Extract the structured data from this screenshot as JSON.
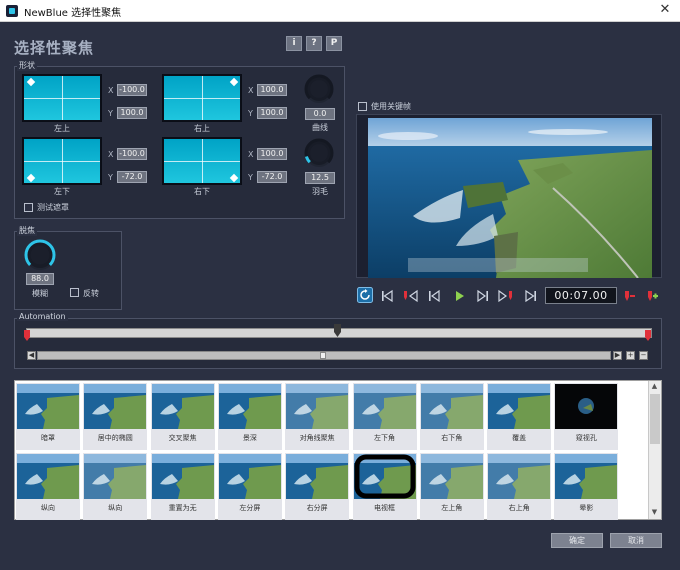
{
  "window": {
    "title": "NewBlue 选择性聚焦",
    "close": "✕"
  },
  "heading": "选择性聚焦",
  "header_buttons": {
    "info": "i",
    "help": "?",
    "presets": "P"
  },
  "shape": {
    "label": "形状",
    "top_left": {
      "label": "左上",
      "x": "-100.0",
      "y": "100.0"
    },
    "top_right": {
      "label": "右上",
      "x": "100.0",
      "y": "100.0"
    },
    "bottom_left": {
      "label": "左下",
      "x": "-100.0",
      "y": "-72.0"
    },
    "bottom_right": {
      "label": "右下",
      "x": "100.0",
      "y": "-72.0"
    },
    "curve": {
      "label": "曲线",
      "value": "0.0"
    },
    "feather": {
      "label": "羽毛",
      "value": "12.5"
    },
    "test_mask": {
      "label": "测试遮罩",
      "checked": false
    },
    "x_label": "X",
    "y_label": "Y"
  },
  "defocus": {
    "label": "脱焦",
    "blur": {
      "label": "模糊",
      "value": "88.0"
    },
    "invert": {
      "label": "反转",
      "checked": false
    }
  },
  "use_keyframes": {
    "label": "使用关键帧",
    "checked": false
  },
  "transport": {
    "timecode": "00:07.00"
  },
  "automation": {
    "label": "Automation"
  },
  "presets": [
    {
      "label": "暗罩"
    },
    {
      "label": "居中的椭圆"
    },
    {
      "label": "交叉聚焦"
    },
    {
      "label": "景深"
    },
    {
      "label": "对角线聚焦"
    },
    {
      "label": "左下角"
    },
    {
      "label": "右下角"
    },
    {
      "label": "覆盖"
    },
    {
      "label": "窥视孔"
    },
    {
      "label": "纵向"
    },
    {
      "label": "纵向"
    },
    {
      "label": "重置为无"
    },
    {
      "label": "左分屏"
    },
    {
      "label": "右分屏"
    },
    {
      "label": "电视框"
    },
    {
      "label": "左上角"
    },
    {
      "label": "右上角"
    },
    {
      "label": "晕影"
    }
  ],
  "footer": {
    "ok": "确定",
    "cancel": "取消"
  },
  "colors": {
    "background": "#2b3042",
    "accent": "#2ec4e8",
    "keyframe": "#e0303a",
    "play": "#8ed14f"
  }
}
